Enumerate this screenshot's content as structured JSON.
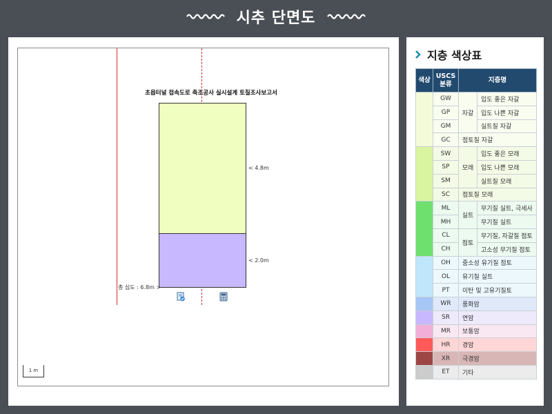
{
  "header": {
    "title": "시추 단면도"
  },
  "section": {
    "report_title": "초읍터널 접속도로 축조공사 실시설계 토질조사보고서",
    "layers": [
      {
        "depth_label": "< 4.8m",
        "color": "#f0ffc0"
      },
      {
        "depth_label": "< 2.0m",
        "color": "#c8b8ff"
      }
    ],
    "total_depth_label": "총 심도 : 6.8m >",
    "scale_label": "1 m",
    "line_color": "#d9262b"
  },
  "legend": {
    "heading": "지층 색상표",
    "columns": {
      "color": "색상",
      "uscs": "USCS\n분류",
      "name": "지층명"
    },
    "header_color": "#214a6e",
    "groups": [
      {
        "label": "자갈",
        "color": "#f4fbd9"
      },
      {
        "label": "모래",
        "color": "#d9f5a0"
      },
      {
        "label": "실트",
        "color": "#6ee06e"
      },
      {
        "label": "점토",
        "color": "#6ee06e"
      }
    ],
    "rows": [
      {
        "code": "GW",
        "name": "입도 좋은 자갈",
        "swatch": "#f4fbd9",
        "bg": "#f8fdf0"
      },
      {
        "code": "GP",
        "name": "입도 나쁜 자갈",
        "swatch": "#f4fbd9",
        "bg": "#f8fdf0"
      },
      {
        "code": "GM",
        "name": "실트질 자갈",
        "swatch": "#f4fbd9",
        "bg": "#f8fdf0"
      },
      {
        "code": "GC",
        "name": "점토질 자갈",
        "swatch": "#f4fbd9",
        "bg": "#f8fdf0"
      },
      {
        "code": "SW",
        "name": "입도 좋은 모래",
        "swatch": "#d9f5a0",
        "bg": "#f3fbe6"
      },
      {
        "code": "SP",
        "name": "입도 나쁜 모래",
        "swatch": "#d9f5a0",
        "bg": "#f3fbe6"
      },
      {
        "code": "SM",
        "name": "실트질 모래",
        "swatch": "#d9f5a0",
        "bg": "#f3fbe6"
      },
      {
        "code": "SC",
        "name": "점토질 모래",
        "swatch": "#d9f5a0",
        "bg": "#f3fbe6"
      },
      {
        "code": "ML",
        "name": "무기질 실트, 극세사",
        "swatch": "#6ee06e",
        "bg": "#ecfaf0"
      },
      {
        "code": "MH",
        "name": "무기질 실트",
        "swatch": "#6ee06e",
        "bg": "#ecfaf0"
      },
      {
        "code": "CL",
        "name": "무기질, 자갈질 점토",
        "swatch": "#6ee06e",
        "bg": "#ecfaf0"
      },
      {
        "code": "CH",
        "name": "고소성 무기질 점토",
        "swatch": "#6ee06e",
        "bg": "#ecfaf0"
      },
      {
        "code": "OH",
        "name": "중소성 유기질 점토",
        "swatch": "#bfe6fb",
        "bg": "#edf8fd"
      },
      {
        "code": "OL",
        "name": "유기질 실트",
        "swatch": "#bfe6fb",
        "bg": "#edf8fd"
      },
      {
        "code": "PT",
        "name": "이탄 및 고유기질토",
        "swatch": "#bfe6fb",
        "bg": "#edf8fd"
      },
      {
        "code": "WR",
        "name": "풍화암",
        "swatch": "#a6c6f5",
        "bg": "#dfe9f9"
      },
      {
        "code": "SR",
        "name": "연암",
        "swatch": "#c8b8ff",
        "bg": "#eee9fb"
      },
      {
        "code": "MR",
        "name": "보통암",
        "swatch": "#f2b0d8",
        "bg": "#f9e8f2"
      },
      {
        "code": "HR",
        "name": "경암",
        "swatch": "#ff5a5a",
        "bg": "#ffd6d6"
      },
      {
        "code": "XR",
        "name": "극경암",
        "swatch": "#9e4545",
        "bg": "#d9b6b6"
      },
      {
        "code": "ET",
        "name": "기타",
        "swatch": "#cccccc",
        "bg": "#ececec"
      }
    ]
  }
}
